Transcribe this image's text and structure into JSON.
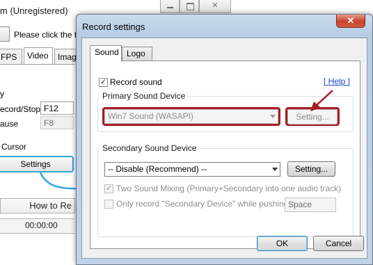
{
  "background_window": {
    "title": "m (Unregistered)",
    "hint_text": "Please click the tar",
    "tabs": [
      {
        "label": "FPS"
      },
      {
        "label": "Video"
      },
      {
        "label": "Image"
      }
    ],
    "section_label": "y",
    "hotkeys": [
      {
        "label": "ecord/Stop",
        "value": "F12",
        "enabled": true
      },
      {
        "label": "ause",
        "value": "F8",
        "enabled": false
      }
    ],
    "cursor_label": "Cursor",
    "settings_label": "Settings",
    "howto_label": "How to Re",
    "status_time": "00:00:00"
  },
  "dialog": {
    "title": "Record settings",
    "close_glyph": "✕",
    "tabs": [
      {
        "label": "Sound",
        "active": true
      },
      {
        "label": "Logo",
        "active": false
      }
    ],
    "record_sound": {
      "label": "Record sound",
      "checked": true
    },
    "help_label": "[ Help ]",
    "primary": {
      "group_title": "Primary Sound Device",
      "device": "Win7 Sound (WASAPI)",
      "setting_label": "Setting..."
    },
    "secondary": {
      "group_title": "Secondary Sound Device",
      "device": "-- Disable (Recommend) --",
      "setting_label": "Setting...",
      "two_mixing": {
        "label": "Two Sound Mixing (Primary+Secondary into one audio track)",
        "checked": true
      },
      "only_secondary": {
        "label": "Only record \"Secondary Device\" while pushing",
        "checked": false
      },
      "hotkey_value": "Space"
    },
    "ok_label": "OK",
    "cancel_label": "Cancel"
  },
  "annotation_colors": {
    "highlight_red": "#a61b23",
    "highlight_blue": "#2ea6e0"
  }
}
